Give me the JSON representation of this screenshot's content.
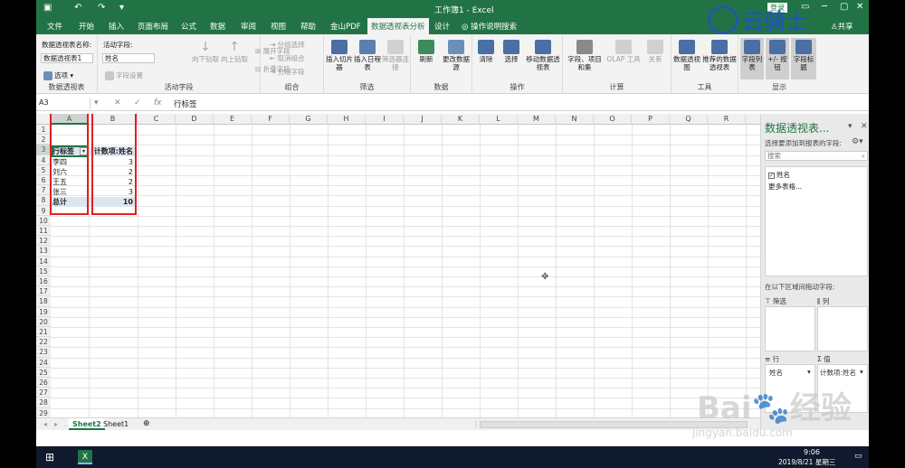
{
  "window": {
    "title": "工作簿1 - Excel",
    "login_label": "登录",
    "share_label": "共享"
  },
  "tabs": [
    "文件",
    "开始",
    "插入",
    "页面布局",
    "公式",
    "数据",
    "审阅",
    "视图",
    "帮助",
    "金山PDF",
    "数据透视表分析",
    "设计"
  ],
  "tell_me": "操作说明搜索",
  "ribbon": {
    "pivot_group": {
      "name_label": "数据透视表名称:",
      "name_value": "数据透视表1",
      "options_label": "选项",
      "group_label": "数据透视表"
    },
    "active_field_group": {
      "field_label": "活动字段:",
      "field_value": "姓名",
      "field_settings": "字段设置",
      "drill_down": "向下钻取",
      "drill_up": "向上钻取",
      "expand": "展开字段",
      "collapse": "折叠字段",
      "group_label": "活动字段"
    },
    "group_group": {
      "group_selection": "分组选择",
      "ungroup": "取消组合",
      "group_field": "分组字段",
      "group_label": "组合"
    },
    "filter_group": {
      "insert_slicer": "插入切片器",
      "insert_timeline": "插入日程表",
      "filter_connections": "筛选器连接",
      "group_label": "筛选"
    },
    "data_group": {
      "refresh": "刷新",
      "change_source": "更改数据源",
      "group_label": "数据"
    },
    "actions_group": {
      "clear": "清除",
      "select": "选择",
      "move": "移动数据透视表",
      "group_label": "操作"
    },
    "calc_group": {
      "fields_items": "字段、项目和集",
      "olap": "OLAP 工具",
      "relationships": "关系",
      "group_label": "计算"
    },
    "tools_group": {
      "pivot_chart": "数据透视图",
      "recommended": "推荐的数据透视表",
      "group_label": "工具"
    },
    "show_group": {
      "field_list": "字段列表",
      "buttons": "+/- 按钮",
      "headers": "字段标题",
      "group_label": "显示"
    }
  },
  "formula_bar": {
    "name_box": "A3",
    "content": "行标签"
  },
  "columns": [
    "A",
    "B",
    "C",
    "D",
    "E",
    "F",
    "G",
    "H",
    "I",
    "J",
    "K",
    "L",
    "M",
    "N",
    "O",
    "P",
    "Q",
    "R"
  ],
  "rows": [
    "1",
    "2",
    "3",
    "4",
    "5",
    "6",
    "7",
    "8",
    "9",
    "10",
    "11",
    "12",
    "13",
    "14",
    "15",
    "16",
    "17",
    "18",
    "19",
    "20",
    "21",
    "22",
    "23",
    "24",
    "25",
    "26",
    "27",
    "28",
    "29"
  ],
  "pivot_table": {
    "header_label": "行标签",
    "header_value": "计数项:姓名",
    "rows": [
      {
        "name": "李四",
        "count": "3"
      },
      {
        "name": "刘六",
        "count": "2"
      },
      {
        "name": "王五",
        "count": "2"
      },
      {
        "name": "张三",
        "count": "3"
      }
    ],
    "total_label": "总计",
    "total_value": "10"
  },
  "sheets": [
    "Sheet2",
    "Sheet1"
  ],
  "pane": {
    "title": "数据透视表...",
    "subtitle": "选择要添加到报表的字段:",
    "search_placeholder": "搜索",
    "fields": [
      {
        "name": "姓名",
        "checked": true
      }
    ],
    "more_tables": "更多表格...",
    "drag_hint": "在以下区域间拖动字段:",
    "filters": "筛选",
    "columns": "列",
    "rows": "行",
    "values": "值",
    "rows_item": "姓名",
    "values_item": "计数项:姓名"
  },
  "taskbar": {
    "time": "9:06",
    "date": "2019/8/21 星期三"
  },
  "watermarks": {
    "top_logo": "云骑士",
    "baidu": "Bai",
    "baidu_cn": "经验",
    "baidu_url": "jingyan.baidu.com"
  }
}
